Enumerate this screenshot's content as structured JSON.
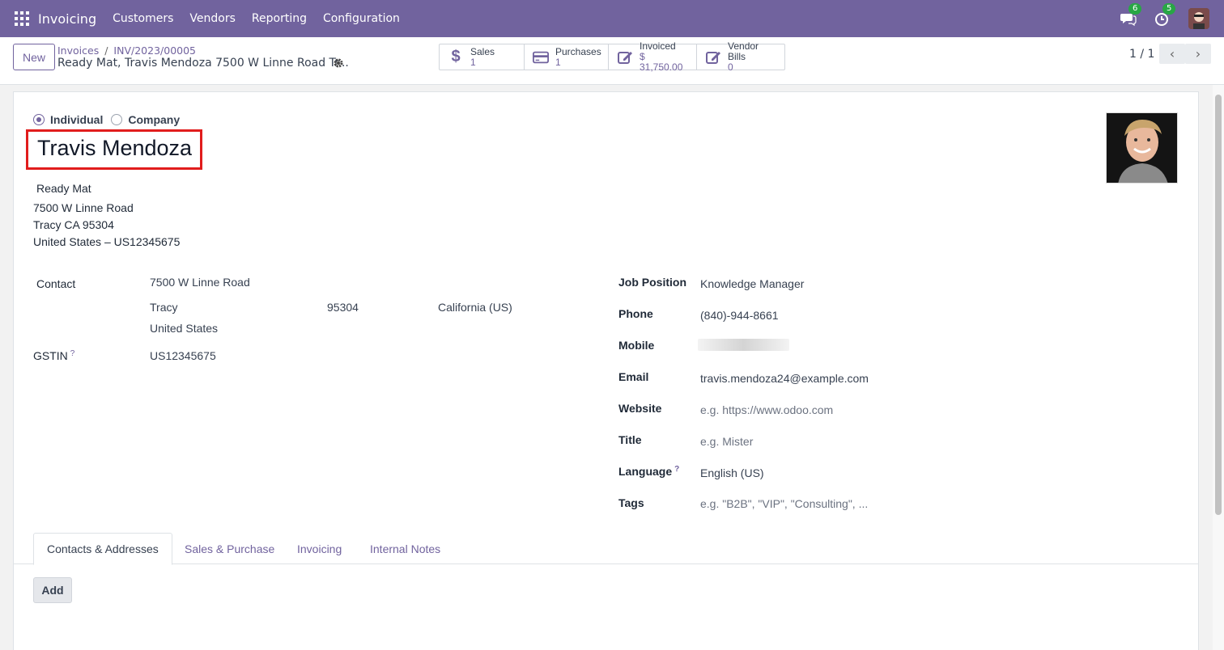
{
  "navbar": {
    "brand": "Invoicing",
    "menu": [
      "Customers",
      "Vendors",
      "Reporting",
      "Configuration"
    ],
    "messages_count": "6",
    "activities_count": "5"
  },
  "control": {
    "new_label": "New",
    "breadcrumb": [
      "Invoices",
      "INV/2023/00005"
    ],
    "record_title": "Ready Mat, Travis Mendoza 7500 W Linne Road Tr...",
    "smart_buttons": [
      {
        "label": "Sales",
        "value": "1",
        "icon": "dollar-icon"
      },
      {
        "label": "Purchases",
        "value": "1",
        "icon": "credit-card-icon"
      },
      {
        "label": "Invoiced",
        "value": "$ 31,750.00",
        "icon": "edit-icon"
      },
      {
        "label": "Vendor Bills",
        "value": "0",
        "icon": "edit-icon"
      }
    ],
    "pager": "1 / 1"
  },
  "form": {
    "type_options": [
      "Individual",
      "Company"
    ],
    "selected_type": "Individual",
    "name": "Travis Mendoza",
    "company": "Ready Mat",
    "address_lines": [
      "7500 W Linne Road",
      "Tracy CA 95304",
      "United States – US12345675"
    ],
    "contact_label": "Contact",
    "street": "7500 W Linne Road",
    "city": "Tracy",
    "zip": "95304",
    "state": "California (US)",
    "country": "United States",
    "gstin_label": "GSTIN",
    "gstin": "US12345675",
    "right_fields": [
      {
        "label": "Job Position",
        "value": "Knowledge Manager",
        "placeholder": false
      },
      {
        "label": "Phone",
        "value": "(840)-944-8661",
        "placeholder": false
      },
      {
        "label": "Mobile",
        "value": "",
        "placeholder": false
      },
      {
        "label": "Email",
        "value": "travis.mendoza24@example.com",
        "placeholder": false
      },
      {
        "label": "Website",
        "value": "e.g. https://www.odoo.com",
        "placeholder": true
      },
      {
        "label": "Title",
        "value": "e.g. Mister",
        "placeholder": true
      },
      {
        "label": "Language",
        "value": "English (US)",
        "placeholder": false
      },
      {
        "label": "Tags",
        "value": "e.g. \"B2B\", \"VIP\", \"Consulting\", ...",
        "placeholder": true
      }
    ],
    "help_mark": "?"
  },
  "tabs": [
    "Contacts & Addresses",
    "Sales & Purchase",
    "Invoicing",
    "Internal Notes"
  ],
  "active_tab": "Contacts & Addresses",
  "add_label": "Add",
  "colors": {
    "brand": "#71639e",
    "highlight": "#e11d1d"
  }
}
